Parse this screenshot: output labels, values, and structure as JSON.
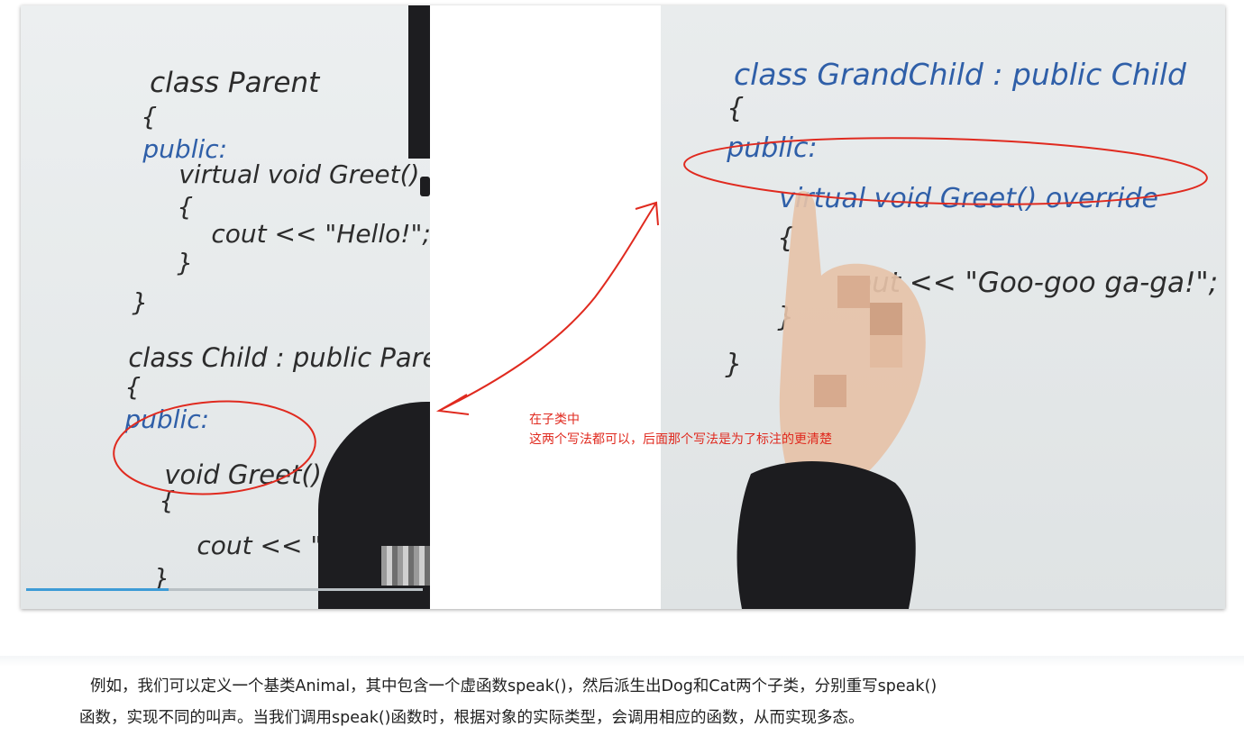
{
  "left_board": {
    "lines": [
      "class Parent",
      "{",
      "public:",
      "virtual void Greet()",
      "{",
      "cout << \"Hello!\";",
      "}",
      "}",
      "class Child : public Parent",
      "{",
      "public:",
      "void Greet()",
      "{",
      "cout << \"What",
      "}",
      "}"
    ]
  },
  "right_board": {
    "lines": [
      "class GrandChild : public Child",
      "{",
      "public:",
      "virtual void Greet() override",
      "{",
      "out << \"Goo-goo ga-ga!\";",
      "}",
      "}"
    ]
  },
  "video": {
    "progress": 0.36
  },
  "annotation": {
    "line1": "在子类中",
    "line2": "这两个写法都可以，后面那个写法是为了标注的更清楚"
  },
  "paragraph": {
    "line1": "例如，我们可以定义一个基类Animal，其中包含一个虚函数speak()，然后派生出Dog和Cat两个子类，分别重写speak()",
    "line2": "函数，实现不同的叫声。当我们调用speak()函数时，根据对象的实际类型，会调用相应的函数，从而实现多态。"
  },
  "colors": {
    "annotation_red": "#e02a1f",
    "marker_blue": "#2f5fa8",
    "progress_blue": "#3d9bd6"
  }
}
